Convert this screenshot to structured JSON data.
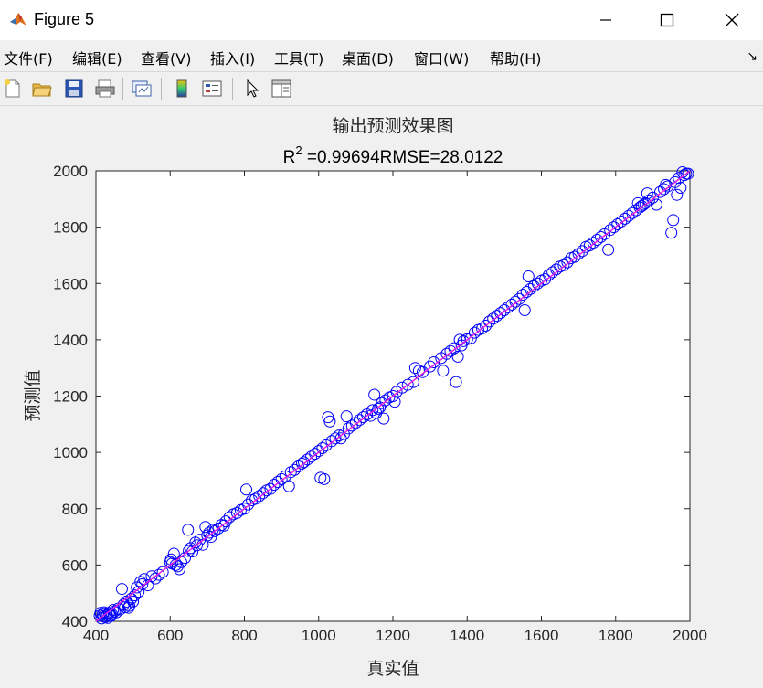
{
  "window": {
    "title": "Figure 5"
  },
  "menu": [
    {
      "label": "文件(F)"
    },
    {
      "label": "编辑(E)"
    },
    {
      "label": "查看(V)"
    },
    {
      "label": "插入(I)"
    },
    {
      "label": "工具(T)"
    },
    {
      "label": "桌面(D)"
    },
    {
      "label": "窗口(W)"
    },
    {
      "label": "帮助(H)"
    }
  ],
  "toolbar": {
    "icons": [
      "new-figure-icon",
      "open-file-icon",
      "save-icon",
      "print-icon",
      "link-plot-icon",
      "insert-colorbar-icon",
      "insert-legend-icon",
      "edit-plot-icon",
      "property-inspector-icon"
    ]
  },
  "chart_data": {
    "type": "scatter",
    "title_line1": "输出预测效果图",
    "title_r_prefix": "R",
    "title_r_sup": "2",
    "title_rest": " =0.99694RMSE=28.0122",
    "xlabel": "真实值",
    "ylabel": "预测值",
    "xlim": [
      400,
      2000
    ],
    "ylim": [
      400,
      2000
    ],
    "xticks": [
      400,
      600,
      800,
      1000,
      1200,
      1400,
      1600,
      1800,
      2000
    ],
    "yticks": [
      400,
      600,
      800,
      1000,
      1200,
      1400,
      1600,
      1800,
      2000
    ],
    "grid": false,
    "marker_color": "#0000ff",
    "line_color": "#e020e0",
    "fit_line": {
      "x": [
        400,
        2000
      ],
      "y": [
        400,
        2000
      ]
    },
    "points": [
      [
        410,
        420
      ],
      [
        412,
        430
      ],
      [
        415,
        410
      ],
      [
        418,
        425
      ],
      [
        420,
        418
      ],
      [
        422,
        432
      ],
      [
        425,
        415
      ],
      [
        428,
        428
      ],
      [
        430,
        422
      ],
      [
        432,
        412
      ],
      [
        435,
        430
      ],
      [
        438,
        420
      ],
      [
        440,
        418
      ],
      [
        443,
        425
      ],
      [
        446,
        440
      ],
      [
        450,
        435
      ],
      [
        455,
        432
      ],
      [
        460,
        445
      ],
      [
        465,
        442
      ],
      [
        470,
        515
      ],
      [
        475,
        460
      ],
      [
        478,
        450
      ],
      [
        482,
        470
      ],
      [
        485,
        462
      ],
      [
        488,
        448
      ],
      [
        490,
        455
      ],
      [
        495,
        480
      ],
      [
        500,
        470
      ],
      [
        505,
        492
      ],
      [
        510,
        520
      ],
      [
        515,
        505
      ],
      [
        520,
        540
      ],
      [
        525,
        532
      ],
      [
        530,
        550
      ],
      [
        540,
        528
      ],
      [
        550,
        560
      ],
      [
        560,
        552
      ],
      [
        570,
        565
      ],
      [
        580,
        575
      ],
      [
        600,
        610
      ],
      [
        602,
        620
      ],
      [
        605,
        605
      ],
      [
        610,
        640
      ],
      [
        615,
        600
      ],
      [
        620,
        595
      ],
      [
        625,
        585
      ],
      [
        630,
        610
      ],
      [
        640,
        625
      ],
      [
        648,
        725
      ],
      [
        650,
        650
      ],
      [
        655,
        660
      ],
      [
        660,
        648
      ],
      [
        668,
        680
      ],
      [
        672,
        670
      ],
      [
        680,
        690
      ],
      [
        688,
        672
      ],
      [
        695,
        735
      ],
      [
        700,
        705
      ],
      [
        705,
        715
      ],
      [
        710,
        700
      ],
      [
        715,
        725
      ],
      [
        720,
        720
      ],
      [
        730,
        730
      ],
      [
        738,
        742
      ],
      [
        745,
        740
      ],
      [
        750,
        755
      ],
      [
        760,
        770
      ],
      [
        770,
        780
      ],
      [
        780,
        785
      ],
      [
        790,
        795
      ],
      [
        800,
        800
      ],
      [
        805,
        868
      ],
      [
        810,
        815
      ],
      [
        820,
        830
      ],
      [
        830,
        835
      ],
      [
        840,
        845
      ],
      [
        850,
        855
      ],
      [
        860,
        865
      ],
      [
        870,
        870
      ],
      [
        880,
        885
      ],
      [
        890,
        895
      ],
      [
        900,
        905
      ],
      [
        910,
        915
      ],
      [
        920,
        880
      ],
      [
        925,
        930
      ],
      [
        935,
        938
      ],
      [
        945,
        950
      ],
      [
        955,
        960
      ],
      [
        960,
        965
      ],
      [
        970,
        975
      ],
      [
        980,
        985
      ],
      [
        990,
        995
      ],
      [
        1000,
        1005
      ],
      [
        1005,
        910
      ],
      [
        1010,
        1015
      ],
      [
        1015,
        905
      ],
      [
        1020,
        1025
      ],
      [
        1025,
        1125
      ],
      [
        1030,
        1110
      ],
      [
        1035,
        1040
      ],
      [
        1045,
        1050
      ],
      [
        1055,
        1060
      ],
      [
        1060,
        1050
      ],
      [
        1068,
        1065
      ],
      [
        1075,
        1128
      ],
      [
        1080,
        1085
      ],
      [
        1090,
        1095
      ],
      [
        1100,
        1105
      ],
      [
        1110,
        1115
      ],
      [
        1120,
        1125
      ],
      [
        1130,
        1135
      ],
      [
        1140,
        1130
      ],
      [
        1145,
        1150
      ],
      [
        1150,
        1205
      ],
      [
        1155,
        1140
      ],
      [
        1160,
        1155
      ],
      [
        1165,
        1160
      ],
      [
        1170,
        1175
      ],
      [
        1175,
        1120
      ],
      [
        1180,
        1185
      ],
      [
        1190,
        1195
      ],
      [
        1200,
        1200
      ],
      [
        1205,
        1180
      ],
      [
        1210,
        1215
      ],
      [
        1225,
        1230
      ],
      [
        1240,
        1240
      ],
      [
        1255,
        1250
      ],
      [
        1260,
        1300
      ],
      [
        1270,
        1290
      ],
      [
        1280,
        1285
      ],
      [
        1300,
        1305
      ],
      [
        1310,
        1320
      ],
      [
        1330,
        1335
      ],
      [
        1335,
        1290
      ],
      [
        1345,
        1350
      ],
      [
        1355,
        1360
      ],
      [
        1365,
        1370
      ],
      [
        1370,
        1250
      ],
      [
        1375,
        1340
      ],
      [
        1380,
        1400
      ],
      [
        1385,
        1380
      ],
      [
        1390,
        1395
      ],
      [
        1400,
        1402
      ],
      [
        1410,
        1405
      ],
      [
        1420,
        1425
      ],
      [
        1430,
        1435
      ],
      [
        1440,
        1440
      ],
      [
        1450,
        1450
      ],
      [
        1460,
        1465
      ],
      [
        1470,
        1475
      ],
      [
        1480,
        1485
      ],
      [
        1490,
        1495
      ],
      [
        1500,
        1505
      ],
      [
        1510,
        1515
      ],
      [
        1520,
        1525
      ],
      [
        1530,
        1535
      ],
      [
        1540,
        1545
      ],
      [
        1550,
        1560
      ],
      [
        1555,
        1505
      ],
      [
        1560,
        1570
      ],
      [
        1565,
        1625
      ],
      [
        1570,
        1580
      ],
      [
        1580,
        1590
      ],
      [
        1590,
        1600
      ],
      [
        1600,
        1610
      ],
      [
        1610,
        1615
      ],
      [
        1620,
        1630
      ],
      [
        1630,
        1640
      ],
      [
        1640,
        1650
      ],
      [
        1650,
        1660
      ],
      [
        1660,
        1665
      ],
      [
        1670,
        1675
      ],
      [
        1680,
        1690
      ],
      [
        1690,
        1695
      ],
      [
        1700,
        1705
      ],
      [
        1710,
        1715
      ],
      [
        1720,
        1730
      ],
      [
        1730,
        1735
      ],
      [
        1740,
        1745
      ],
      [
        1750,
        1755
      ],
      [
        1760,
        1765
      ],
      [
        1770,
        1775
      ],
      [
        1780,
        1720
      ],
      [
        1785,
        1790
      ],
      [
        1795,
        1800
      ],
      [
        1805,
        1810
      ],
      [
        1815,
        1820
      ],
      [
        1825,
        1830
      ],
      [
        1835,
        1840
      ],
      [
        1845,
        1850
      ],
      [
        1855,
        1860
      ],
      [
        1860,
        1885
      ],
      [
        1865,
        1870
      ],
      [
        1870,
        1875
      ],
      [
        1875,
        1880
      ],
      [
        1880,
        1885
      ],
      [
        1885,
        1920
      ],
      [
        1890,
        1895
      ],
      [
        1900,
        1905
      ],
      [
        1910,
        1880
      ],
      [
        1920,
        1925
      ],
      [
        1930,
        1935
      ],
      [
        1935,
        1950
      ],
      [
        1940,
        1945
      ],
      [
        1950,
        1780
      ],
      [
        1955,
        1825
      ],
      [
        1960,
        1960
      ],
      [
        1965,
        1915
      ],
      [
        1970,
        1975
      ],
      [
        1975,
        1940
      ],
      [
        1980,
        1995
      ],
      [
        1985,
        1985
      ],
      [
        1990,
        1990
      ],
      [
        1995,
        1990
      ]
    ]
  }
}
